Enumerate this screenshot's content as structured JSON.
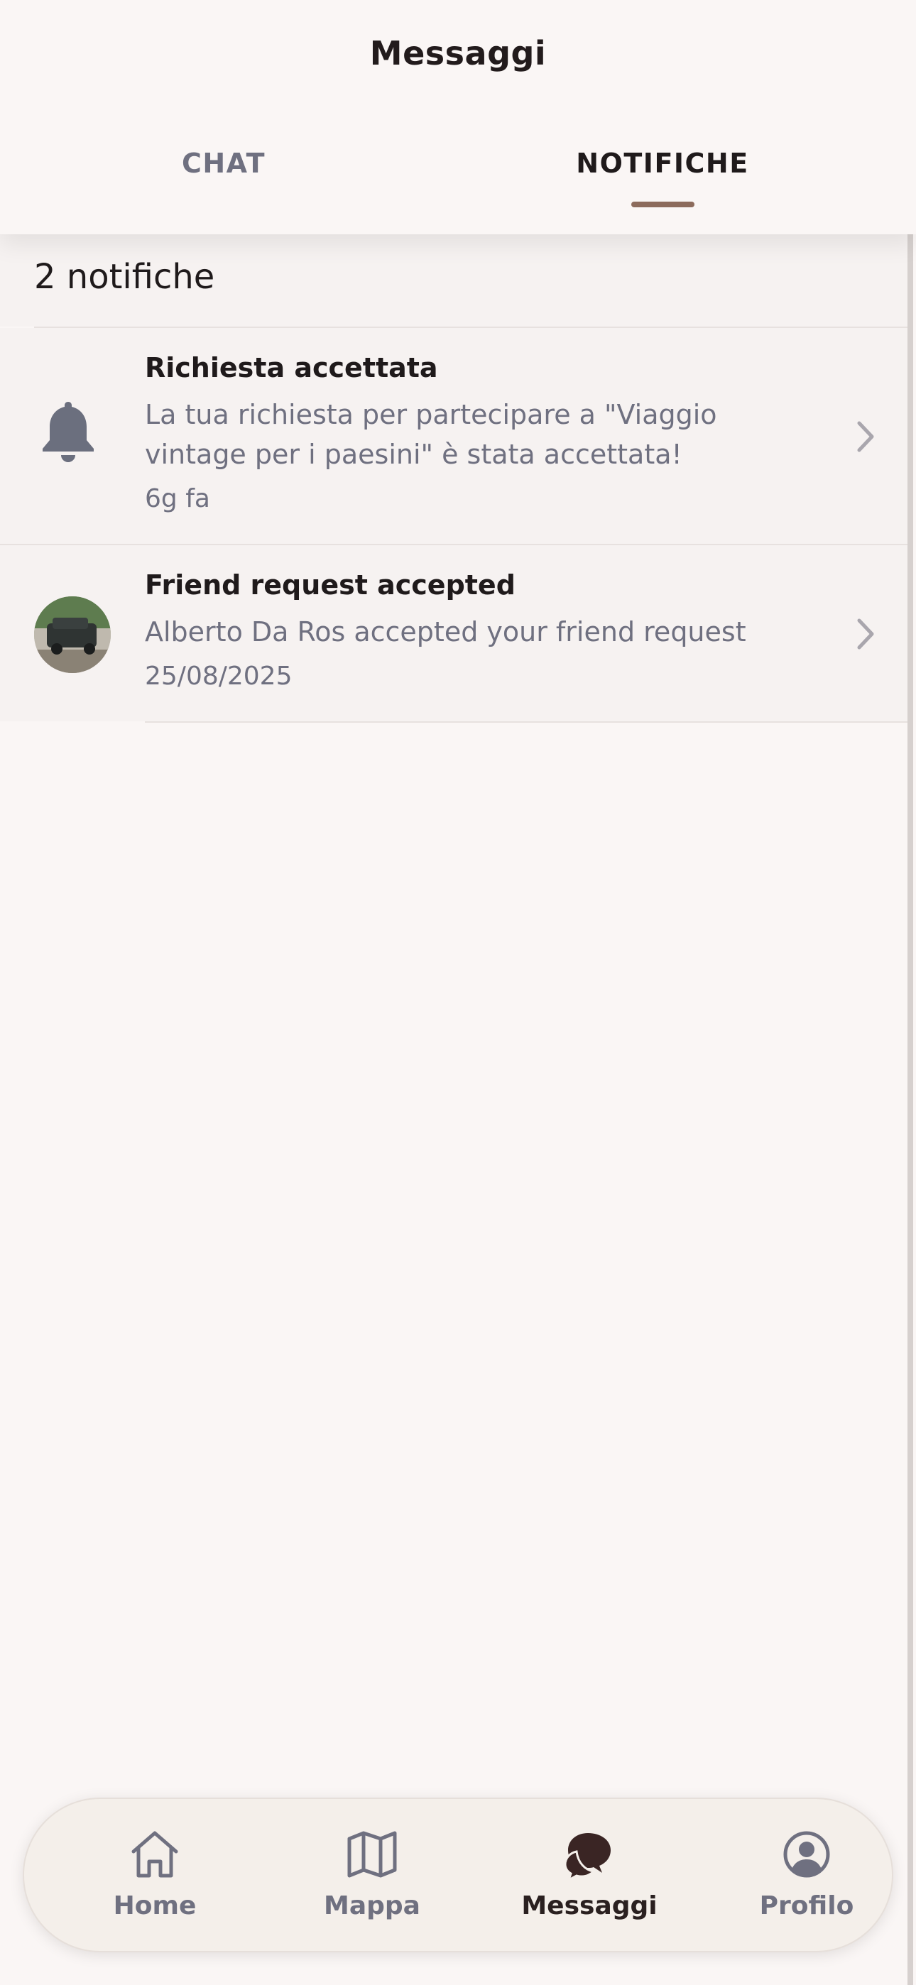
{
  "header": {
    "title": "Messaggi",
    "tabs": [
      {
        "label": "CHAT",
        "active": false
      },
      {
        "label": "NOTIFICHE",
        "active": true
      }
    ]
  },
  "notifications": {
    "count_label": "2 notifiche",
    "items": [
      {
        "icon": "bell-icon",
        "title": "Richiesta accettata",
        "body": "La tua richiesta per partecipare a \"Viaggio vintage per i paesini\" è stata accettata!",
        "time": "6g fa"
      },
      {
        "icon": "avatar",
        "title": "Friend request accepted",
        "body": "Alberto Da Ros accepted your friend request",
        "time": "25/08/2025"
      }
    ]
  },
  "bottom_nav": {
    "items": [
      {
        "label": "Home",
        "icon": "home-icon",
        "active": false
      },
      {
        "label": "Mappa",
        "icon": "map-icon",
        "active": false
      },
      {
        "label": "Messaggi",
        "icon": "chat-bubbles-icon",
        "active": true
      },
      {
        "label": "Profilo",
        "icon": "profile-icon",
        "active": false
      }
    ]
  },
  "colors": {
    "background": "#faf6f5",
    "accent": "#8c6b5c",
    "muted_text": "#6f7080",
    "primary_text": "#1f1a1b"
  }
}
